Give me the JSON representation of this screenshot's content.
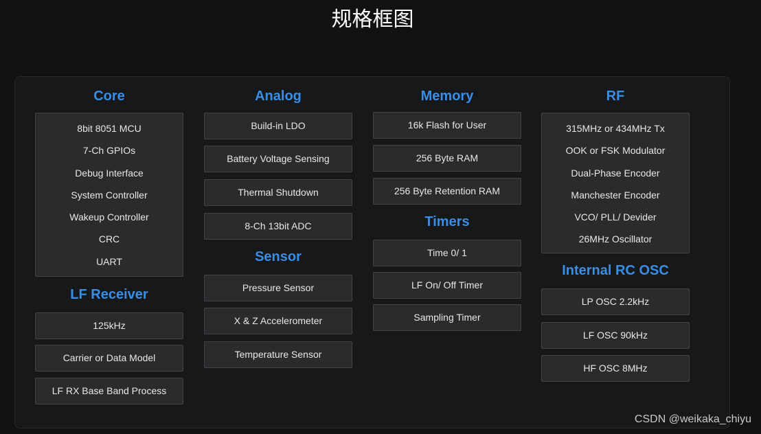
{
  "title": "规格框图",
  "colors": {
    "background": "#121213",
    "panel": "#17181a",
    "heading": "#3a8ee6",
    "box": "#2a2b2d",
    "box_border": "#414346",
    "text": "#e8e8e8"
  },
  "core": {
    "heading": "Core",
    "items": [
      "8bit 8051 MCU",
      "7-Ch GPIOs",
      "Debug Interface",
      "System Controller",
      "Wakeup Controller",
      "CRC",
      "UART"
    ]
  },
  "lf_receiver": {
    "heading": "LF Receiver",
    "items": [
      "125kHz",
      "Carrier or Data Model",
      "LF RX Base Band Process"
    ]
  },
  "analog": {
    "heading": "Analog",
    "items": [
      "Build-in LDO",
      "Battery Voltage Sensing",
      "Thermal Shutdown",
      "8-Ch 13bit ADC"
    ]
  },
  "sensor": {
    "heading": "Sensor",
    "items": [
      "Pressure Sensor",
      "X & Z Accelerometer",
      "Temperature Sensor"
    ]
  },
  "memory": {
    "heading": "Memory",
    "items": [
      "16k Flash for User",
      "256 Byte RAM",
      "256 Byte Retention RAM"
    ]
  },
  "timers": {
    "heading": "Timers",
    "items": [
      "Time 0/ 1",
      "LF On/ Off Timer",
      "Sampling Timer"
    ]
  },
  "rf": {
    "heading": "RF",
    "items": [
      "315MHz or 434MHz Tx",
      "OOK or FSK Modulator",
      "Dual-Phase Encoder",
      "Manchester Encoder",
      "VCO/ PLL/ Devider",
      "26MHz Oscillator"
    ]
  },
  "internal_rc_osc": {
    "heading": "Internal RC OSC",
    "items": [
      "LP OSC 2.2kHz",
      "LF OSC 90kHz",
      "HF OSC 8MHz"
    ]
  },
  "watermark": "CSDN @weikaka_chiyu"
}
